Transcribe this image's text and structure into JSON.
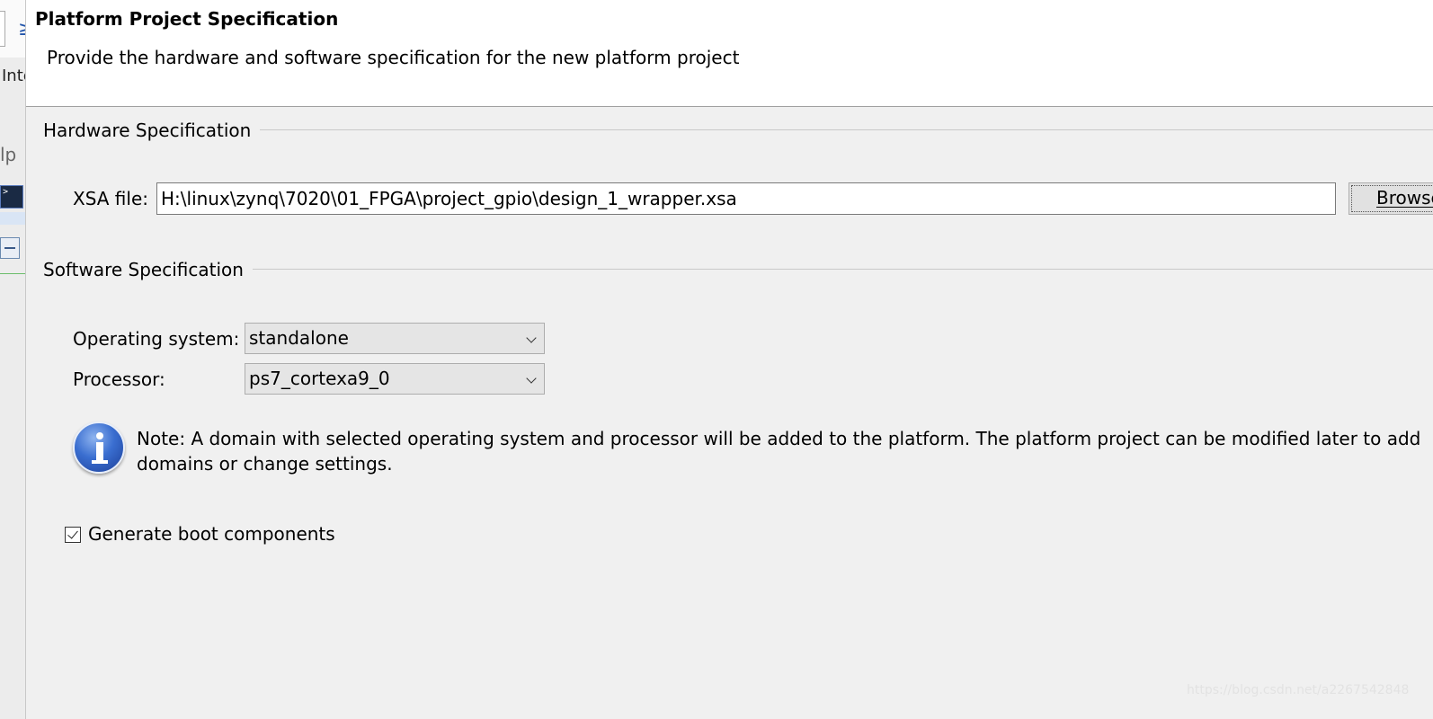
{
  "background_window": {
    "toolbar_glyph": "≥",
    "partial_tab_text": "Inte",
    "partial_menu_text": "lp",
    "terminal_glyph": ">"
  },
  "dialog": {
    "title": "Platform Project Specification",
    "description": "Provide the hardware and software specification for the new platform project"
  },
  "hardware": {
    "group_label": "Hardware Specification",
    "xsa_label": "XSA file:",
    "xsa_value": "H:\\linux\\zynq\\7020\\01_FPGA\\project_gpio\\design_1_wrapper.xsa",
    "browse_label": "Browse..."
  },
  "software": {
    "group_label": "Software Specification",
    "os_label": "Operating system:",
    "os_value": "standalone",
    "processor_label": "Processor:",
    "processor_value": "ps7_cortexa9_0"
  },
  "note": {
    "icon": "info-icon",
    "text": "Note: A domain with selected operating system and processor will be added to the platform. The platform project can be modified later to add domains or change settings."
  },
  "boot": {
    "checked": true,
    "label": "Generate boot components"
  },
  "watermark": "https://blog.csdn.net/a2267542848",
  "colors": {
    "header_bg": "#ffffff",
    "body_bg": "#f0f0f0",
    "info_icon_blue": "#2a56b8"
  }
}
